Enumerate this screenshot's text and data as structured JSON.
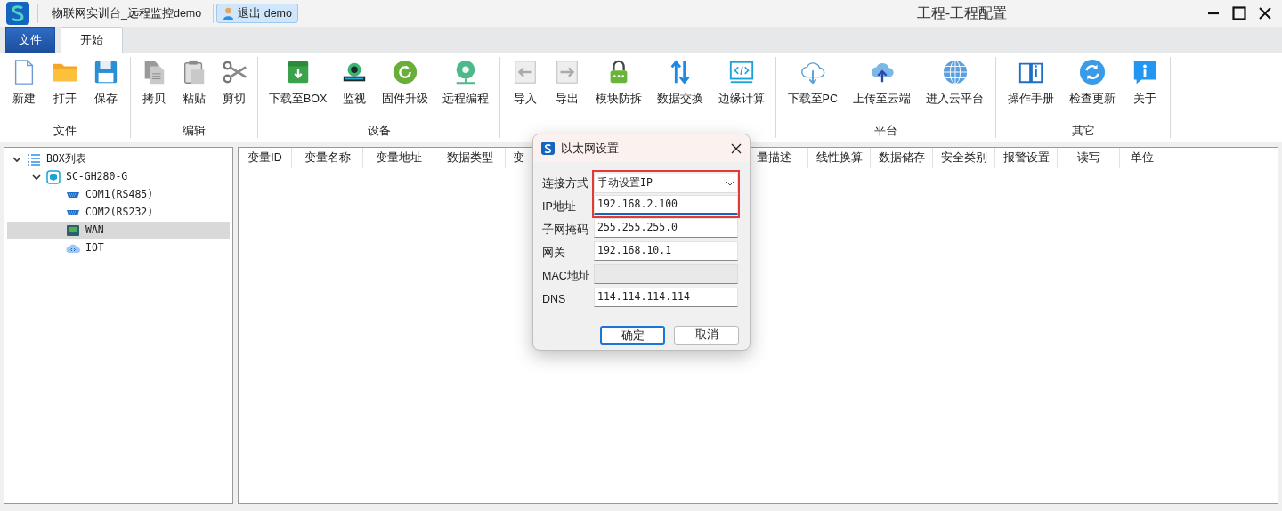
{
  "app_title": "物联网实训台_远程监控demo",
  "user_button": "退出 demo",
  "window_title": "工程-工程配置",
  "tabs": [
    {
      "label": "文件",
      "kind": "menu",
      "selected": false
    },
    {
      "label": "开始",
      "kind": "tab",
      "selected": true
    }
  ],
  "ribbon_groups": [
    {
      "label": "文件",
      "buttons": [
        {
          "label": "新建",
          "kind": "new"
        },
        {
          "label": "打开",
          "kind": "open"
        },
        {
          "label": "保存",
          "kind": "save"
        }
      ]
    },
    {
      "label": "编辑",
      "buttons": [
        {
          "label": "拷贝",
          "kind": "copy"
        },
        {
          "label": "粘贴",
          "kind": "paste"
        },
        {
          "label": "剪切",
          "kind": "cut"
        }
      ]
    },
    {
      "label": "设备",
      "buttons": [
        {
          "label": "下载至BOX",
          "kind": "download_box"
        },
        {
          "label": "监视",
          "kind": "monitor"
        },
        {
          "label": "固件升级",
          "kind": "upgrade"
        },
        {
          "label": "远程编程",
          "kind": "remote"
        }
      ]
    },
    {
      "buttons": [
        {
          "label": "导入",
          "kind": "import"
        },
        {
          "label": "导出",
          "kind": "export"
        },
        {
          "label": "模块防拆",
          "kind": "lock"
        },
        {
          "label": "数据交换",
          "kind": "exchange"
        },
        {
          "label": "边缘计算",
          "kind": "code"
        }
      ]
    },
    {
      "label": "平台",
      "buttons": [
        {
          "label": "下载至PC",
          "kind": "cloud_down"
        },
        {
          "label": "上传至云端",
          "kind": "cloud_up"
        },
        {
          "label": "进入云平台",
          "kind": "globe"
        }
      ]
    },
    {
      "label": "其它",
      "buttons": [
        {
          "label": "操作手册",
          "kind": "book"
        },
        {
          "label": "检查更新",
          "kind": "refresh"
        },
        {
          "label": "关于",
          "kind": "info"
        }
      ]
    }
  ],
  "tree": [
    {
      "label": "BOX列表",
      "kind": "list",
      "expanded": true,
      "selected": false,
      "children": [
        {
          "label": "SC-GH280-G",
          "kind": "device",
          "expanded": true,
          "selected": false,
          "children": [
            {
              "label": "COM1(RS485)",
              "kind": "serial",
              "selected": false
            },
            {
              "label": "COM2(RS232)",
              "kind": "serial",
              "selected": false
            },
            {
              "label": "WAN",
              "kind": "ethernet",
              "selected": true
            },
            {
              "label": "IOT",
              "kind": "cloud",
              "selected": false
            }
          ]
        }
      ]
    }
  ],
  "table": {
    "columns": [
      "变量ID",
      "变量名称",
      "变量地址",
      "数据类型",
      "变",
      "量描述",
      "线性换算",
      "数据储存",
      "安全类别",
      "报警设置",
      "读写",
      "单位"
    ]
  },
  "dialog": {
    "title": "以太网设置",
    "fields": [
      {
        "label": "连接方式",
        "kind": "select",
        "value": "手动设置IP",
        "highlighted": true
      },
      {
        "label": "IP地址",
        "kind": "text",
        "value": "192.168.2.100",
        "focused": true,
        "highlighted": true
      },
      {
        "label": "子网掩码",
        "kind": "text",
        "value": "255.255.255.0"
      },
      {
        "label": "网关",
        "kind": "text",
        "value": "192.168.10.1"
      },
      {
        "label": "MAC地址",
        "kind": "text",
        "disabled": true
      },
      {
        "label": "DNS",
        "kind": "text",
        "value": "114.114.114.114"
      }
    ],
    "buttons": [
      {
        "label": "确定",
        "default": true
      },
      {
        "label": "取消",
        "default": false
      }
    ]
  }
}
